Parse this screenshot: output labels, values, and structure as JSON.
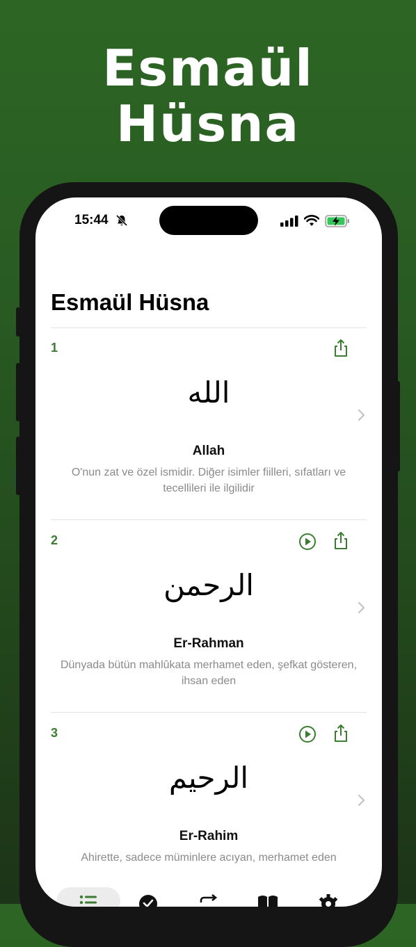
{
  "hero": {
    "line1": "Esmaül",
    "line2": "Hüsna"
  },
  "status_bar": {
    "time": "15:44"
  },
  "page": {
    "title": "Esmaül Hüsna"
  },
  "colors": {
    "accent": "#3a7d30",
    "background_top": "#2d6624",
    "background_bottom": "#1c3417"
  },
  "names": [
    {
      "number": "1",
      "arabic": "الله",
      "name": "Allah",
      "description": "O'nun zat ve özel ismidir. Diğer isimler fiilleri, sıfatları ve tecellileri ile ilgilidir",
      "has_audio": false
    },
    {
      "number": "2",
      "arabic": "الرحمن",
      "name": "Er-Rahman",
      "description": "Dünyada bütün mahlûkata merhamet eden, şefkat gösteren, ihsan eden",
      "has_audio": true
    },
    {
      "number": "3",
      "arabic": "الرحيم",
      "name": "Er-Rahim",
      "description": "Ahirette, sadece müminlere acıyan, merhamet eden",
      "has_audio": true
    }
  ],
  "tabs": [
    {
      "icon": "list-icon",
      "active": true
    },
    {
      "icon": "checkmark-circle-icon",
      "active": false
    },
    {
      "icon": "repeat-icon",
      "active": false
    },
    {
      "icon": "book-icon",
      "active": false
    },
    {
      "icon": "gear-icon",
      "active": false
    }
  ]
}
